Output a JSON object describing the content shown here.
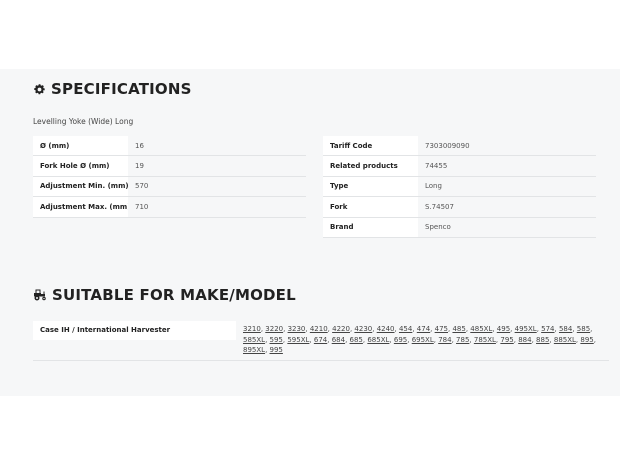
{
  "specifications": {
    "title": "SPECIFICATIONS",
    "icon": "gear-icon",
    "product_name": "Levelling Yoke (Wide) Long",
    "left_table": [
      {
        "label": "Ø (mm)",
        "value": "16"
      },
      {
        "label": "Fork Hole Ø (mm)",
        "value": "19"
      },
      {
        "label": "Adjustment Min. (mm)",
        "value": "570"
      },
      {
        "label": "Adjustment Max. (mm)",
        "value": "710"
      }
    ],
    "right_table": [
      {
        "label": "Tariff Code",
        "value": "7303009090"
      },
      {
        "label": "Related products",
        "value": "74455"
      },
      {
        "label": "Type",
        "value": "Long"
      },
      {
        "label": "Fork",
        "value": "S.74507"
      },
      {
        "label": "Brand",
        "value": "Spenco"
      }
    ]
  },
  "suitable": {
    "title": "SUITABLE FOR MAKE/MODEL",
    "icon": "tractor-icon",
    "rows": [
      {
        "make": "Case IH / International Harvester",
        "models": [
          "3210",
          "3220",
          "3230",
          "4210",
          "4220",
          "4230",
          "4240",
          "454",
          "474",
          "475",
          "485",
          "485XL",
          "495",
          "495XL",
          "574",
          "584",
          "585",
          "585XL",
          "595",
          "595XL",
          "674",
          "684",
          "685",
          "685XL",
          "695",
          "695XL",
          "784",
          "785",
          "785XL",
          "795",
          "884",
          "885",
          "885XL",
          "895",
          "895XL",
          "995"
        ]
      }
    ]
  }
}
